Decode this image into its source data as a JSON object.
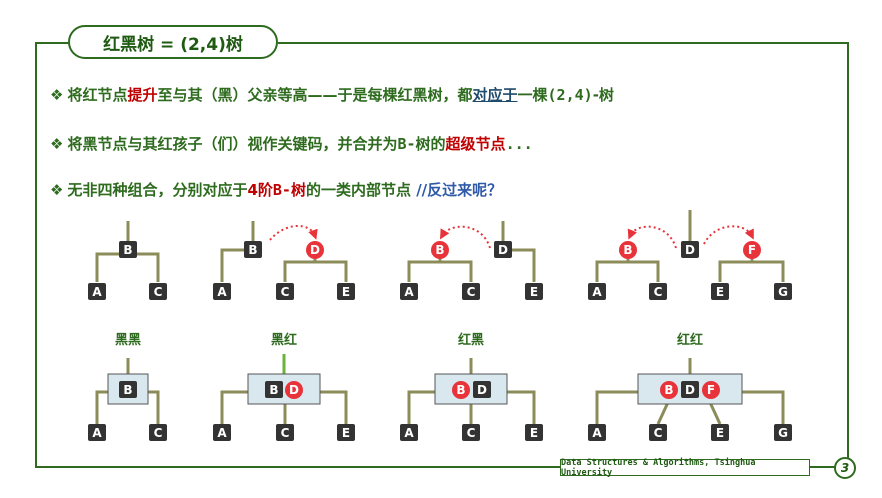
{
  "title": "红黑树 = (2,4)树",
  "bullets": {
    "b1": {
      "mark": "❖",
      "p1": "将红节点",
      "p2": "提升",
      "p3": "至与其（黑）父亲等高——于是每棵红黑树，都",
      "p4": "对应于",
      "p5": "一棵",
      "p6": "(2,4)",
      "p7": "-树"
    },
    "b2": {
      "mark": "❖",
      "p1": "将黑节点与其红孩子（们）视作关键码，并合并为",
      "p2": "B-",
      "p3": "树的",
      "p4": "超级节点",
      "p5": "..."
    },
    "b3": {
      "mark": "❖",
      "p1": "无非四种组合，分别对应于",
      "p2": "4阶",
      "p3": "B-树",
      "p4": "的一类内部节点 ",
      "p5": "//反过来呢？"
    }
  },
  "diagrams": {
    "leaves": {
      "A": "A",
      "B": "B",
      "C": "C",
      "D": "D",
      "E": "E",
      "F": "F",
      "G": "G"
    },
    "labels": {
      "bb": "黑黑",
      "br": "黑红",
      "rb": "红黑",
      "rr": "红红"
    }
  },
  "colors": {
    "green_dark": "#2e6b1f",
    "red_node": "#e8333a",
    "black_node": "#333333",
    "edge": "#8c8c5a",
    "super_fill": "#d9e8ee"
  },
  "footer": "Data Structures & Algorithms, Tsinghua University",
  "page_number": "3"
}
